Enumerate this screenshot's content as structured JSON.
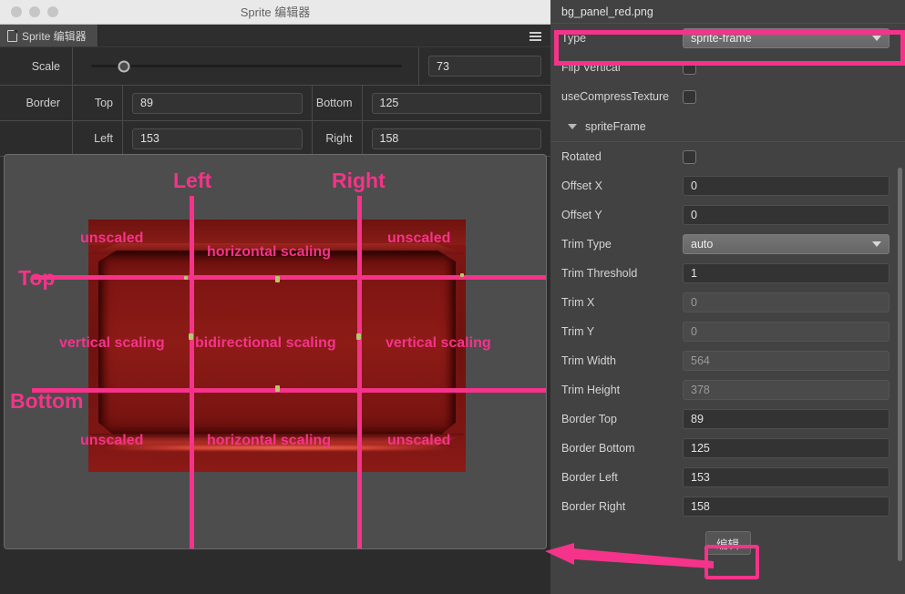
{
  "window": {
    "title": "Sprite 编辑器",
    "tab_label": "Sprite 编辑器",
    "menu_icon": "hamburger-icon",
    "file_icon": "file-icon"
  },
  "properties": {
    "scale_label": "Scale",
    "scale_value": "73",
    "border_label": "Border",
    "top_label": "Top",
    "top_value": "89",
    "bottom_label": "Bottom",
    "bottom_value": "125",
    "left_label": "Left",
    "left_value": "153",
    "right_label": "Right",
    "right_value": "158"
  },
  "canvas": {
    "guides": {
      "top": "Top",
      "bottom": "Bottom",
      "left": "Left",
      "right": "Right"
    },
    "regions": {
      "tl": "unscaled",
      "tc": "horizontal scaling",
      "tr": "unscaled",
      "ml": "vertical scaling",
      "mc": "bidirectional scaling",
      "mr": "vertical scaling",
      "bl": "unscaled",
      "bc": "horizontal scaling",
      "br": "unscaled"
    }
  },
  "inspector": {
    "asset_name": "bg_panel_red.png",
    "type_label": "Type",
    "type_value": "sprite-frame",
    "flip_vertical_label": "Flip Vertical",
    "flip_vertical_checked": false,
    "use_compress_texture_label": "useCompressTexture",
    "use_compress_texture_checked": false,
    "section_label": "spriteFrame",
    "fields": [
      {
        "label": "Rotated",
        "kind": "checkbox",
        "value": ""
      },
      {
        "label": "Offset X",
        "kind": "input",
        "value": "0"
      },
      {
        "label": "Offset Y",
        "kind": "input",
        "value": "0"
      },
      {
        "label": "Trim Type",
        "kind": "select",
        "value": "auto"
      },
      {
        "label": "Trim Threshold",
        "kind": "input",
        "value": "1"
      },
      {
        "label": "Trim X",
        "kind": "readonly",
        "value": "0"
      },
      {
        "label": "Trim Y",
        "kind": "readonly",
        "value": "0"
      },
      {
        "label": "Trim Width",
        "kind": "readonly",
        "value": "564"
      },
      {
        "label": "Trim Height",
        "kind": "readonly",
        "value": "378"
      },
      {
        "label": "Border Top",
        "kind": "input",
        "value": "89"
      },
      {
        "label": "Border Bottom",
        "kind": "input",
        "value": "125"
      },
      {
        "label": "Border Left",
        "kind": "input",
        "value": "153"
      },
      {
        "label": "Border Right",
        "kind": "input",
        "value": "158"
      }
    ],
    "edit_button_label": "编辑"
  },
  "colors": {
    "highlight_pink": "#f5338a",
    "panel_bg": "#424242",
    "canvas_bg": "#4d4d4d",
    "sprite_red": "#8d1b16"
  }
}
